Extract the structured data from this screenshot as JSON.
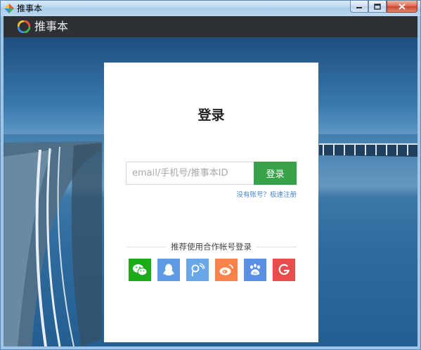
{
  "window": {
    "title": "推事本",
    "minimize_icon": "minimize-icon",
    "maximize_icon": "maximize-icon",
    "close_icon": "close-icon"
  },
  "appbar": {
    "brand": "推事本",
    "logo_icon": "ring-logo-icon"
  },
  "login": {
    "heading": "登录",
    "input_placeholder": "email/手机号/推事本ID",
    "input_value": "",
    "button_label": "登录",
    "register_link": "没有账号？极速注册"
  },
  "social": {
    "caption": "推荐使用合作帐号登录",
    "providers": [
      {
        "name": "wechat",
        "icon": "wechat-icon",
        "color": "#1aad19"
      },
      {
        "name": "qq",
        "icon": "qq-penguin-icon",
        "color": "#5d9be6"
      },
      {
        "name": "tencent-weibo",
        "icon": "tencent-weibo-icon",
        "color": "#6aa7e8"
      },
      {
        "name": "sina-weibo",
        "icon": "sina-weibo-icon",
        "color": "#f7834a"
      },
      {
        "name": "baidu",
        "icon": "baidu-paw-icon",
        "color": "#5b8fe6"
      },
      {
        "name": "google",
        "icon": "google-g-icon",
        "color": "#e84c4c"
      }
    ]
  },
  "colors": {
    "appbar_bg": "#2d3035",
    "login_button": "#37a24a",
    "link": "#4a86c8"
  }
}
